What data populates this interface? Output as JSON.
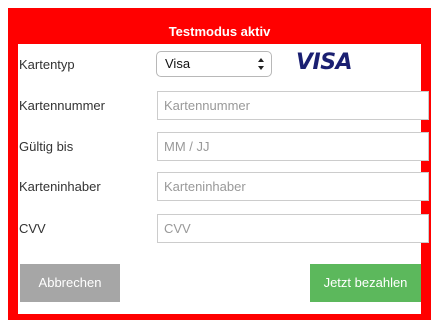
{
  "header": {
    "title": "Testmodus aktiv"
  },
  "form": {
    "card_type": {
      "label": "Kartentyp",
      "selected": "Visa"
    },
    "card_number": {
      "label": "Kartennummer",
      "placeholder": "Kartennummer"
    },
    "expiry": {
      "label": "Gültig bis",
      "placeholder": "MM / JJ"
    },
    "holder": {
      "label": "Karteninhaber",
      "placeholder": "Karteninhaber"
    },
    "cvv": {
      "label": "CVV",
      "placeholder": "CVV"
    }
  },
  "brand": {
    "logo_text": "VISA",
    "logo_color": "#1a1f71"
  },
  "actions": {
    "cancel_label": "Abbrechen",
    "pay_label": "Jetzt bezahlen"
  },
  "colors": {
    "frame_accent": "#ff0000",
    "cancel_button": "#a6a6a6",
    "pay_button": "#5cb85c"
  }
}
